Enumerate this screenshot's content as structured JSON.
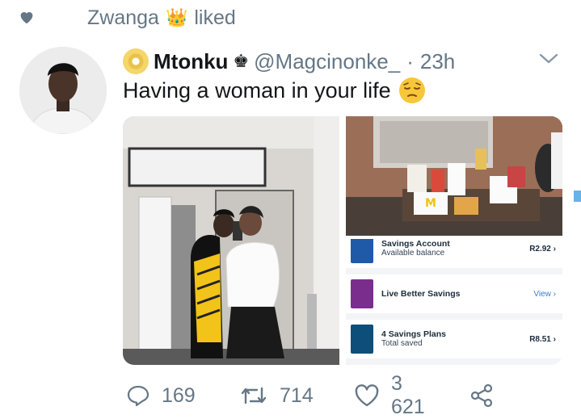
{
  "social_context": {
    "name": "Zwanga",
    "action": "liked",
    "crown_emoji": "👑"
  },
  "tweet": {
    "display_name": "Mtonku",
    "owner_badge": "♚",
    "handle": "@Magcinonke_",
    "separator": "·",
    "time": "23h",
    "text": "Having a woman in your life"
  },
  "bank_card": {
    "rows": [
      {
        "title": "Savings Account",
        "subtitle": "Available balance",
        "value": "R2.92",
        "chevron": "›",
        "icon_color": "#1e5aa8"
      },
      {
        "title": "Live Better Savings",
        "subtitle": "",
        "value": "View",
        "chevron": "›",
        "icon_color": "#7b2d8e"
      },
      {
        "title": "4 Savings Plans",
        "subtitle": "Total saved",
        "value": "R8.51",
        "chevron": "›",
        "icon_color": "#0d4e7a"
      }
    ]
  },
  "actions": {
    "reply_count": "169",
    "retweet_count": "714",
    "like_count": "3 621"
  },
  "colors": {
    "muted": "#657786",
    "text": "#14171a"
  },
  "icons": [
    "heart-icon",
    "caret-down-icon",
    "reply-icon",
    "retweet-icon",
    "like-icon",
    "share-icon",
    "crown-icon",
    "dvd-emoji-icon",
    "pensive-emoji-icon"
  ]
}
